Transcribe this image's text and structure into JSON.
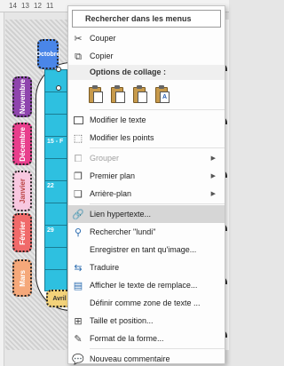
{
  "ruler": {
    "numbers": [
      "14",
      "13",
      "12",
      "11"
    ]
  },
  "document": {
    "months": [
      "Octobre",
      "Novembre",
      "Décembre",
      "Janvier",
      "Février",
      "Mars",
      "Avril"
    ],
    "cells": [
      "",
      "",
      "",
      "15 - F",
      "",
      "22",
      "",
      "29",
      ""
    ]
  },
  "menu": {
    "search_placeholder": "Rechercher dans les menus",
    "cut": "Couper",
    "copy": "Copier",
    "paste_options_header": "Options de collage :",
    "paste_icons": [
      "paste-keep-source-icon",
      "paste-merge-icon",
      "paste-picture-icon",
      "paste-text-only-icon"
    ],
    "paste_letters": [
      "",
      "",
      "",
      "A"
    ],
    "edit_text": "Modifier le texte",
    "edit_points": "Modifier les points",
    "group": "Grouper",
    "bring_front": "Premier plan",
    "send_back": "Arrière-plan",
    "hyperlink": "Lien hypertexte...",
    "search_word": "Rechercher \"lundi\"",
    "save_as_image": "Enregistrer en tant qu'image...",
    "translate": "Traduire",
    "alt_text": "Afficher le texte de remplace...",
    "set_default": "Définir comme zone de texte ...",
    "size_position": "Taille et position...",
    "format_shape": "Format de la forme...",
    "new_comment": "Nouveau commentaire"
  },
  "colors": {
    "highlight": "#d6d6d6",
    "accent": "#2b6cb0",
    "disabled": "#a0a0a0"
  }
}
